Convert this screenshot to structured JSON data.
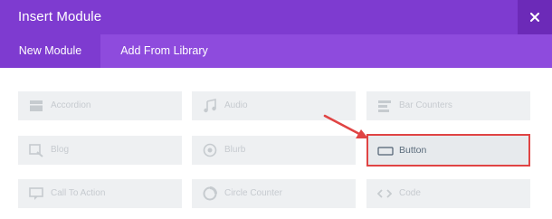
{
  "dialog": {
    "title": "Insert Module",
    "close_icon": "close-icon"
  },
  "tabs": [
    {
      "label": "New Module",
      "active": true
    },
    {
      "label": "Add From Library",
      "active": false
    }
  ],
  "modules": [
    {
      "label": "Accordion",
      "icon": "accordion-icon",
      "highlighted": false
    },
    {
      "label": "Audio",
      "icon": "audio-icon",
      "highlighted": false
    },
    {
      "label": "Bar Counters",
      "icon": "bar-counters-icon",
      "highlighted": false
    },
    {
      "label": "Blog",
      "icon": "blog-icon",
      "highlighted": false
    },
    {
      "label": "Blurb",
      "icon": "blurb-icon",
      "highlighted": false
    },
    {
      "label": "Button",
      "icon": "button-icon",
      "highlighted": true
    },
    {
      "label": "Call To Action",
      "icon": "call-to-action-icon",
      "highlighted": false
    },
    {
      "label": "Circle Counter",
      "icon": "circle-counter-icon",
      "highlighted": false
    },
    {
      "label": "Code",
      "icon": "code-icon",
      "highlighted": false
    }
  ],
  "colors": {
    "header": "#7e3bd0",
    "tabs_bar": "#8e4bdd",
    "highlight_border": "#e04444",
    "arrow": "#e04444"
  }
}
